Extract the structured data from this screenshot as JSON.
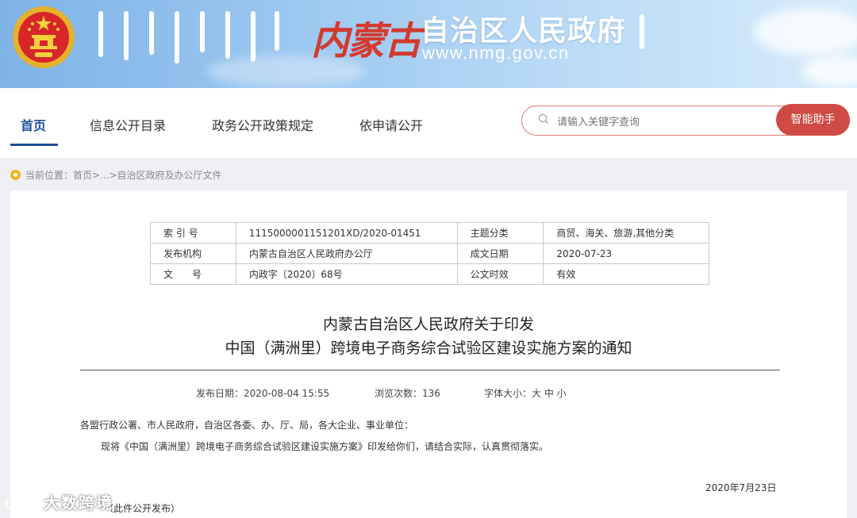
{
  "header": {
    "brush_logo": "内蒙古",
    "title": "自治区人民政府",
    "url": "www.nmg.gov.cn"
  },
  "nav": {
    "items": [
      {
        "label": "首页",
        "active": true
      },
      {
        "label": "信息公开目录",
        "active": false
      },
      {
        "label": "政务公开政策规定",
        "active": false
      },
      {
        "label": "依申请公开",
        "active": false
      }
    ]
  },
  "search": {
    "placeholder": "请输入关键字查询",
    "button_label": "智能助手"
  },
  "breadcrumb": {
    "text": "当前位置：首页>...>自治区政府及办公厅文件"
  },
  "meta_table": {
    "rows": [
      {
        "k1": "索 引 号",
        "v1": "1115000001151201XD/2020-01451",
        "k2": "主题分类",
        "v2": "商贸、海关、旅游,其他分类"
      },
      {
        "k1": "发布机构",
        "v1": "内蒙古自治区人民政府办公厅",
        "k2": "成文日期",
        "v2": "2020-07-23"
      },
      {
        "k1": "文　　号",
        "v1": "内政字〔2020〕68号",
        "k2": "公文时效",
        "v2": "有效"
      }
    ]
  },
  "document": {
    "title_line1": "内蒙古自治区人民政府关于印发",
    "title_line2": "中国（满洲里）跨境电子商务综合试验区建设实施方案的通知",
    "publish_date": "发布日期：2020-08-04 15:55",
    "views": "浏览次数：136",
    "font_size": "字体大小：大 中 小",
    "recipients": "各盟行政公署、市人民政府，自治区各委、办、厅、局，各大企业、事业单位：",
    "paragraph": "现将《中国（满洲里）跨境电子商务综合试验区建设实施方案》印发给你们，请结合实际，认真贯彻落实。",
    "date_signed": "2020年7月23日",
    "note": "（此件公开发布）"
  },
  "watermark": "大数跨境",
  "colors": {
    "accent": "#1f4e9b",
    "button": "#cf4a44"
  }
}
